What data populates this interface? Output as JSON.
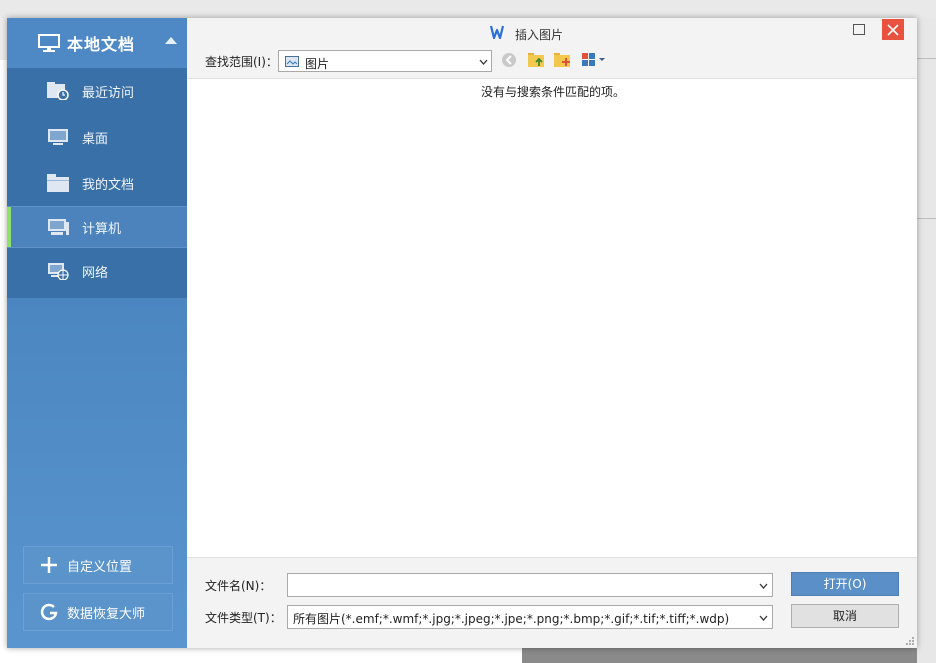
{
  "dialog": {
    "title": "插入图片",
    "colors": {
      "sidebar": "#4a85c0",
      "accent_active": "#8ee06a",
      "close": "#e8523f",
      "open_button": "#5b8fc7"
    }
  },
  "sidebar": {
    "header": "本地文档",
    "items": [
      {
        "label": "最近访问",
        "icon": "recent-folder-icon"
      },
      {
        "label": "桌面",
        "icon": "desktop-icon"
      },
      {
        "label": "我的文档",
        "icon": "folder-icon"
      },
      {
        "label": "计算机",
        "icon": "computer-icon",
        "active": true
      },
      {
        "label": "网络",
        "icon": "network-icon"
      }
    ],
    "custom_location": "自定义位置",
    "data_recovery": "数据恢复大师"
  },
  "toolbar": {
    "lookin_label": "查找范围(I)：",
    "lookin_value": "图片"
  },
  "filelist": {
    "empty_message": "没有与搜索条件匹配的项。"
  },
  "footer": {
    "filename_label": "文件名(N)：",
    "filename_value": "",
    "filetype_label": "文件类型(T)：",
    "filetype_value": "所有图片(*.emf;*.wmf;*.jpg;*.jpeg;*.jpe;*.png;*.bmp;*.gif;*.tif;*.tiff;*.wdp)",
    "open_label": "打开(O)",
    "cancel_label": "取消"
  }
}
